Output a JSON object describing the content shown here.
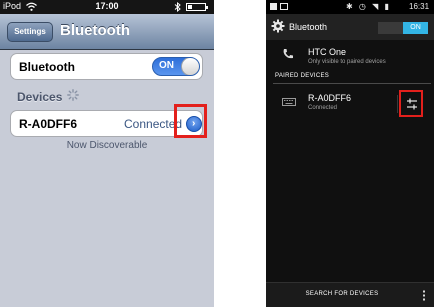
{
  "ios": {
    "status_bar": {
      "carrier": "iPod",
      "time": "17:00",
      "battery_level": 0.25,
      "icons": [
        "wifi-icon",
        "bluetooth-icon",
        "battery-icon"
      ]
    },
    "nav": {
      "back_label": "Settings",
      "title": "Bluetooth"
    },
    "bluetooth_row": {
      "label": "Bluetooth",
      "toggle_label": "ON"
    },
    "devices_header": "Devices",
    "device": {
      "name": "R-A0DFF6",
      "status": "Connected",
      "icon": "disclosure-arrow-icon"
    },
    "discoverable_text": "Now Discoverable",
    "highlight_color": "#e3201c",
    "accent_color": "#3a7be3"
  },
  "android": {
    "status_bar": {
      "time": "16:31",
      "icons": [
        "notification-icon",
        "image-icon",
        "bluetooth-icon",
        "alarm-icon",
        "wifi-icon",
        "signal-icon",
        "battery-icon"
      ]
    },
    "action_bar": {
      "title": "Bluetooth",
      "toggle_label": "ON",
      "icon": "settings-gear-icon"
    },
    "this_device": {
      "name": "HTC One",
      "subtitle": "Only visible to paired devices",
      "icon": "phone-icon"
    },
    "paired_section_label": "PAIRED DEVICES",
    "paired_device": {
      "name": "R-A0DFF6",
      "status": "Connected",
      "icon": "keyboard-icon",
      "settings_icon": "tune-settings-icon"
    },
    "bottom_action": "SEARCH FOR DEVICES",
    "accent_color": "#33b5e5",
    "highlight_color": "#e3201c"
  }
}
